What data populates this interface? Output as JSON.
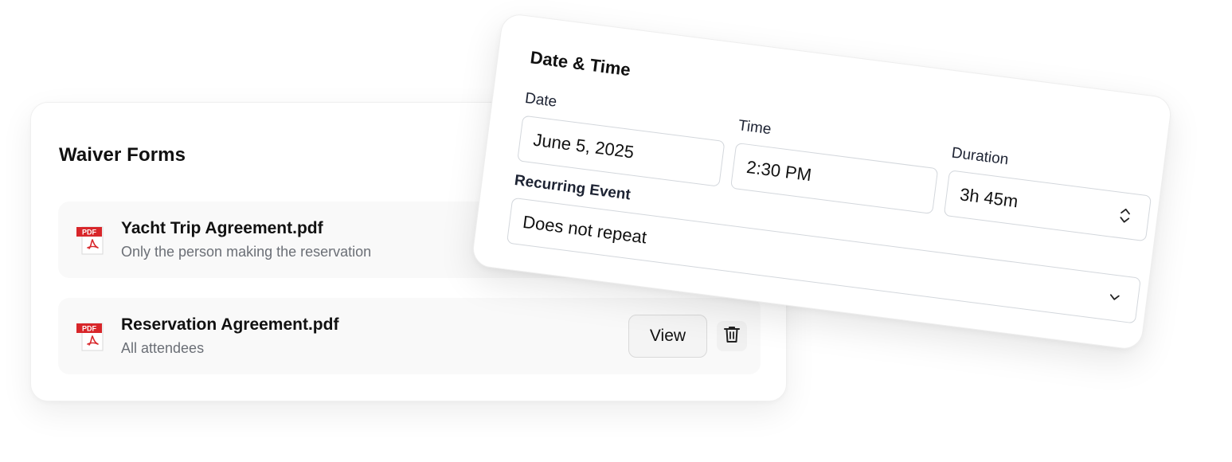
{
  "waiver": {
    "title": "Waiver Forms",
    "forms": [
      {
        "icon": "pdf-file-icon",
        "icon_text": "PDF",
        "name": "Yacht Trip Agreement.pdf",
        "audience": "Only the person making the reservation"
      },
      {
        "icon": "pdf-file-icon",
        "icon_text": "PDF",
        "name": "Reservation Agreement.pdf",
        "audience": "All attendees",
        "view_label": "View",
        "delete_icon": "trash-icon"
      }
    ]
  },
  "datetime": {
    "title": "Date & Time",
    "date_label": "Date",
    "date_value": "June 5, 2025",
    "time_label": "Time",
    "time_value": "2:30 PM",
    "duration_label": "Duration",
    "duration_value": "3h 45m",
    "duration_icon": "up-down-chevron-icon",
    "recurring_label": "Recurring Event",
    "recurring_value": "Does not repeat",
    "recurring_icon": "chevron-down-icon"
  },
  "colors": {
    "pdf_red": "#d8262a",
    "muted_text": "#6b6f76",
    "row_bg": "#f9f9f9",
    "border": "#d3d7dc"
  }
}
